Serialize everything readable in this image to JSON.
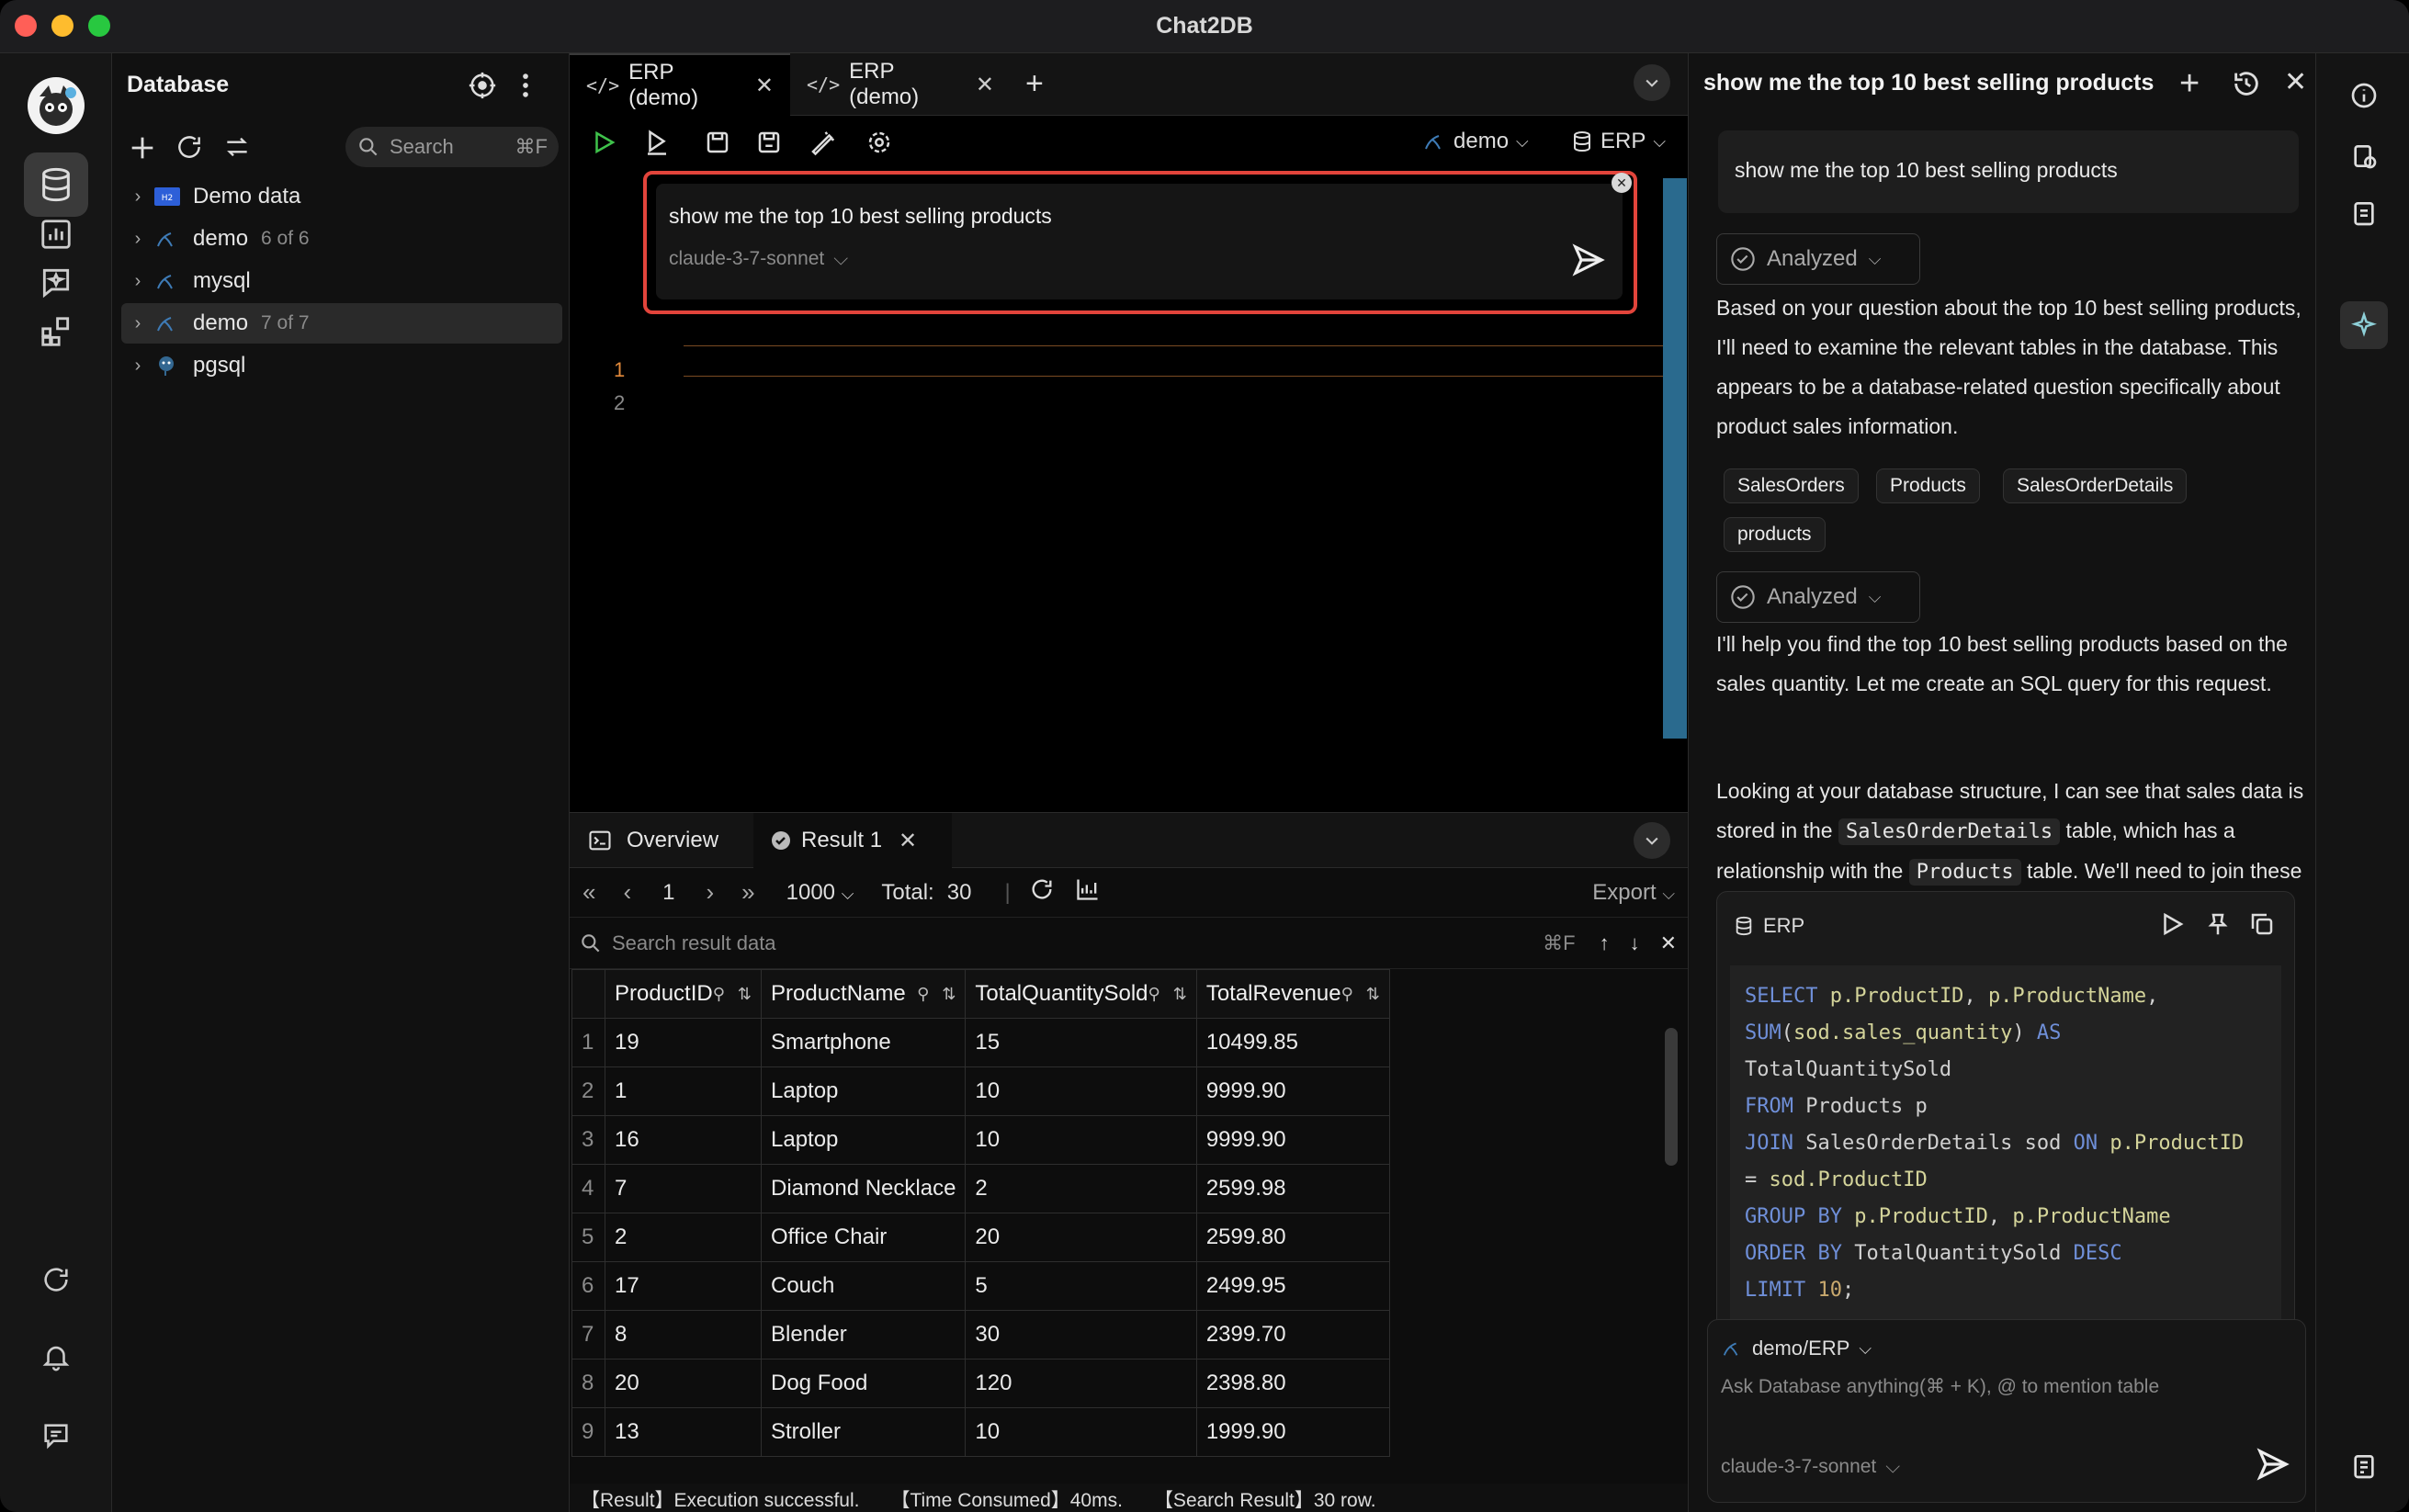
{
  "app": {
    "title": "Chat2DB"
  },
  "db_panel": {
    "title": "Database",
    "search": {
      "placeholder": "Search",
      "shortcut": "⌘F"
    },
    "tree": [
      {
        "label": "Demo data",
        "count": ""
      },
      {
        "label": "demo",
        "count": "6 of 6"
      },
      {
        "label": "mysql",
        "count": ""
      },
      {
        "label": "demo",
        "count": "7 of 7"
      },
      {
        "label": "pgsql",
        "count": ""
      }
    ]
  },
  "editor": {
    "tabs": [
      {
        "label": "ERP (demo)"
      },
      {
        "label": "ERP (demo)"
      }
    ],
    "db_select": "demo",
    "schema_select": "ERP",
    "ai_prompt": {
      "text": "show me the top 10 best selling products",
      "model": "claude-3-7-sonnet"
    },
    "line_numbers": [
      "1",
      "2"
    ]
  },
  "results": {
    "tabs": {
      "overview": "Overview",
      "result": "Result 1"
    },
    "pager": {
      "page": "1",
      "page_size": "1000",
      "total_label": "Total:",
      "total": "30",
      "export": "Export"
    },
    "search": {
      "placeholder": "Search result data",
      "shortcut": "⌘F"
    },
    "columns": [
      "ProductID",
      "ProductName",
      "TotalQuantitySold",
      "TotalRevenue"
    ],
    "rows": [
      [
        "1",
        "19",
        "Smartphone",
        "15",
        "10499.85"
      ],
      [
        "2",
        "1",
        "Laptop",
        "10",
        "9999.90"
      ],
      [
        "3",
        "16",
        "Laptop",
        "10",
        "9999.90"
      ],
      [
        "4",
        "7",
        "Diamond Necklace",
        "2",
        "2599.98"
      ],
      [
        "5",
        "2",
        "Office Chair",
        "20",
        "2599.80"
      ],
      [
        "6",
        "17",
        "Couch",
        "5",
        "2499.95"
      ],
      [
        "7",
        "8",
        "Blender",
        "30",
        "2399.70"
      ],
      [
        "8",
        "20",
        "Dog Food",
        "120",
        "2398.80"
      ],
      [
        "9",
        "13",
        "Stroller",
        "10",
        "1999.90"
      ]
    ],
    "status": {
      "result": "【Result】Execution successful.",
      "time": "【Time Consumed】40ms.",
      "search": "【Search Result】30 row."
    }
  },
  "chat": {
    "title": "show me the top 10 best selling products",
    "user_message": "show me the top 10 best selling products",
    "analyzed_label": "Analyzed",
    "para1": "Based on your question about the top 10 best selling products, I'll need to examine the relevant tables in the database. This appears to be a database-related question specifically about product sales information.",
    "chips": [
      "SalesOrders",
      "Products",
      "SalesOrderDetails",
      "products"
    ],
    "para2": "I'll help you find the top 10 best selling products based on the sales quantity. Let me create an SQL query for this request.",
    "para3": {
      "a": "Looking at your database structure, I can see that sales data is stored in the",
      "code1": "SalesOrderDetails",
      "b": "table, which has a relationship with the",
      "code2": "Products",
      "c": "table. We'll need to join these tables and aggregate the sales quantities."
    },
    "code_card": {
      "title": "ERP"
    },
    "input": {
      "db": "demo/ERP",
      "placeholder": "Ask Database anything(⌘ + K), @ to mention table",
      "model": "claude-3-7-sonnet"
    }
  },
  "colors": {
    "accent_red": "#e2443b",
    "keyword": "#6f8fd8",
    "scroll": "#2a6a8e"
  },
  "icons": [
    "logo-avatar",
    "database-icon",
    "dashboard-icon",
    "ai-chat-icon",
    "plugins-icon",
    "refresh-icon",
    "bell-icon",
    "feedback-icon",
    "run-icon",
    "save-icon",
    "settings-icon",
    "send-icon"
  ]
}
